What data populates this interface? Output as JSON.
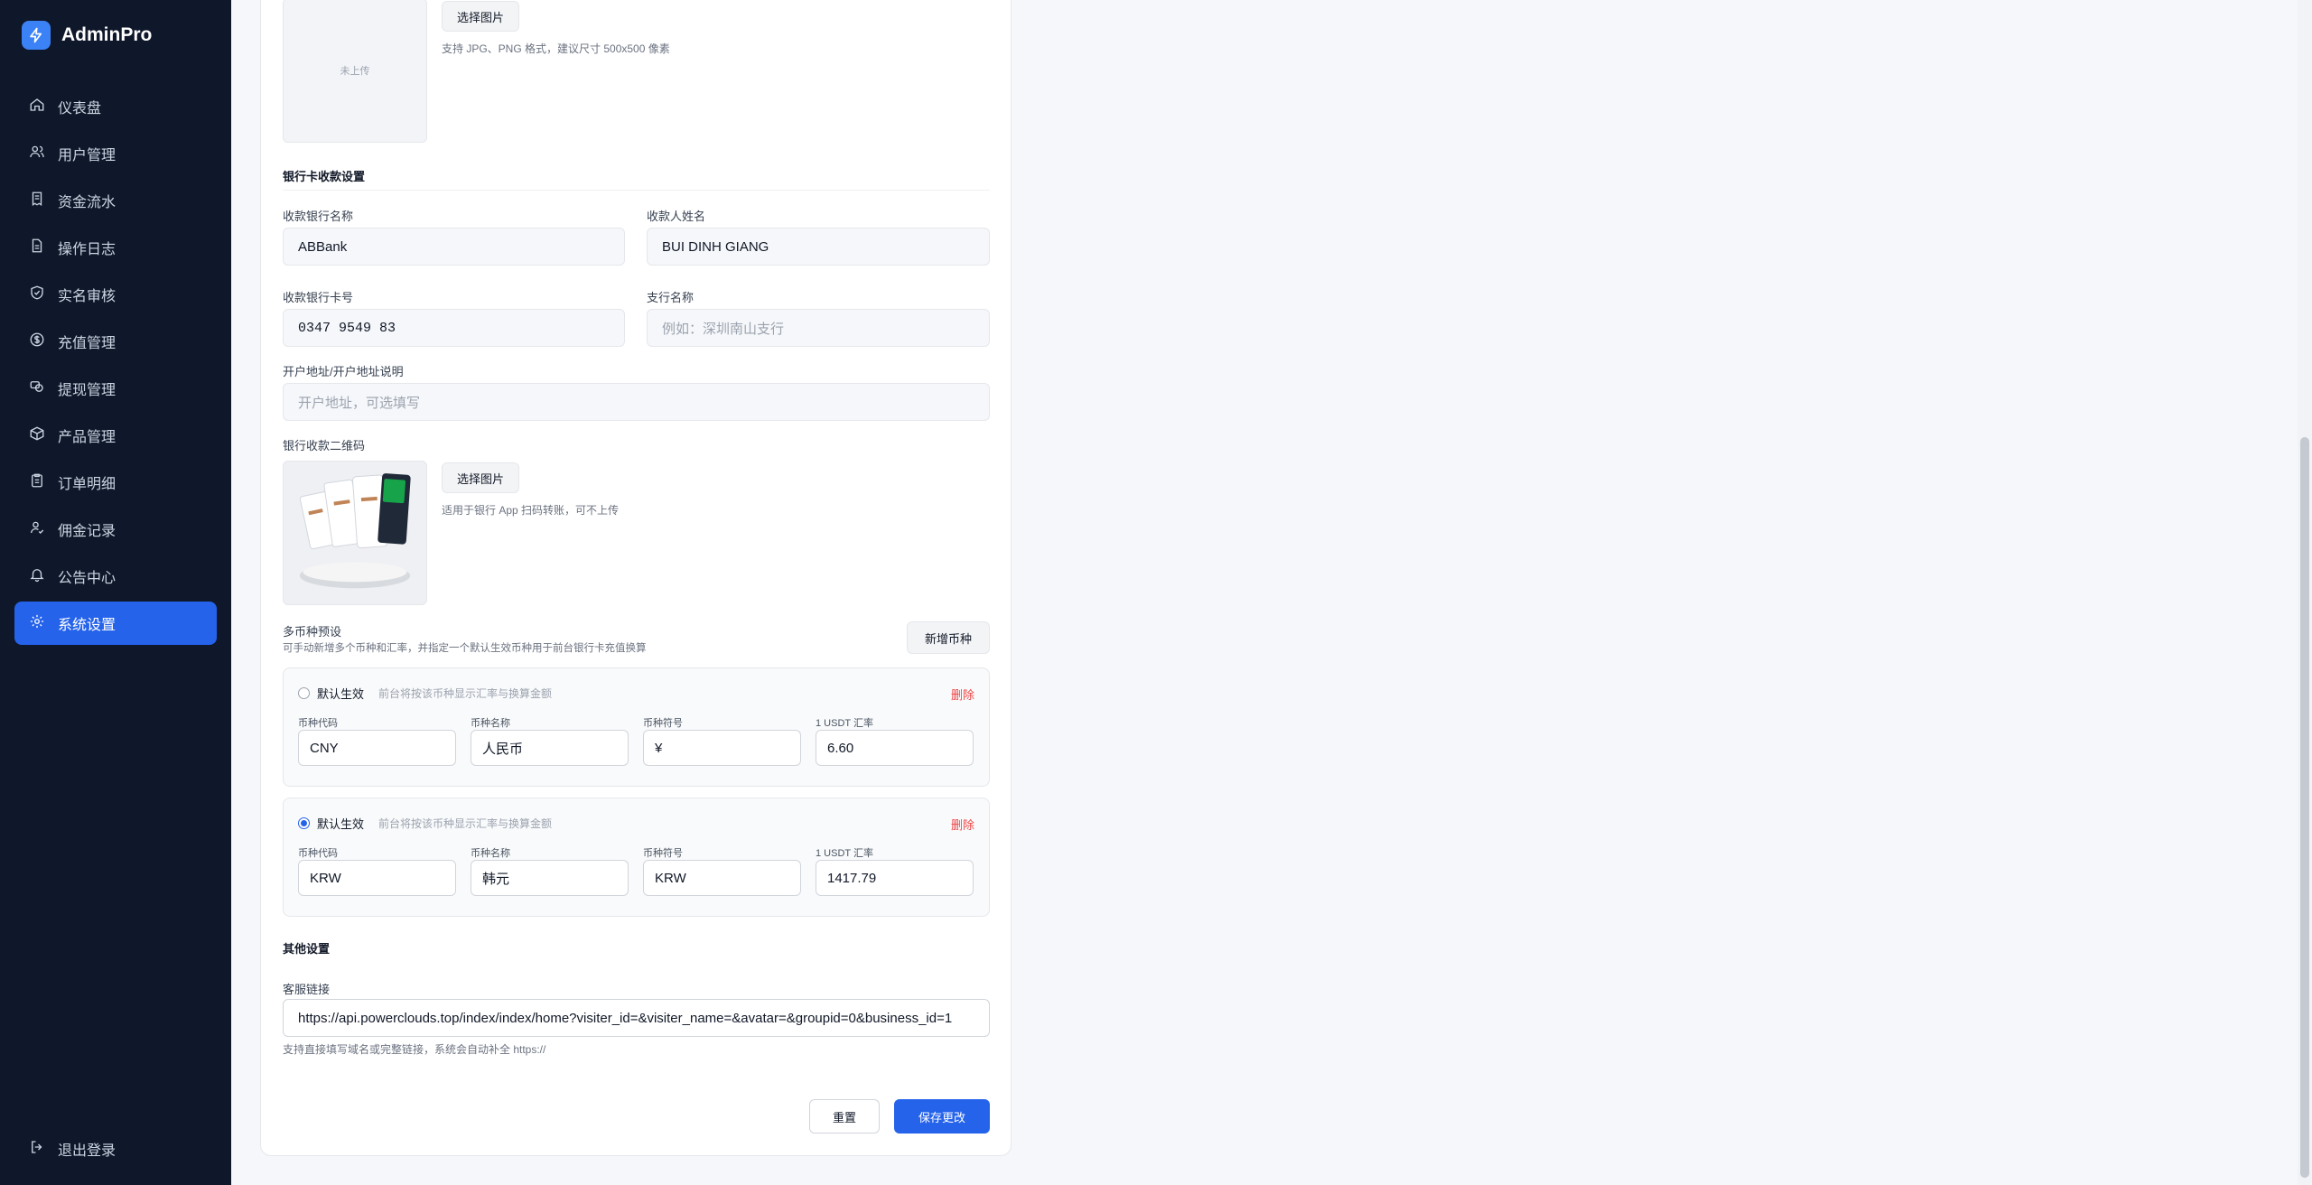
{
  "app": {
    "name": "AdminPro"
  },
  "sidebar": {
    "items": [
      {
        "label": "仪表盘",
        "icon": "home-icon"
      },
      {
        "label": "用户管理",
        "icon": "users-icon"
      },
      {
        "label": "资金流水",
        "icon": "receipt-icon"
      },
      {
        "label": "操作日志",
        "icon": "file-text-icon"
      },
      {
        "label": "实名审核",
        "icon": "shield-check-icon"
      },
      {
        "label": "充值管理",
        "icon": "dollar-circle-icon"
      },
      {
        "label": "提现管理",
        "icon": "coins-icon"
      },
      {
        "label": "产品管理",
        "icon": "box-icon"
      },
      {
        "label": "订单明细",
        "icon": "clipboard-icon"
      },
      {
        "label": "佣金记录",
        "icon": "user-badge-icon"
      },
      {
        "label": "公告中心",
        "icon": "bell-icon"
      },
      {
        "label": "系统设置",
        "icon": "gear-icon",
        "active": true
      }
    ],
    "logout_label": "退出登录"
  },
  "top_upload": {
    "placeholder_text": "未上传",
    "button_label": "选择图片",
    "hint": "支持 JPG、PNG 格式，建议尺寸 500x500 像素"
  },
  "bank": {
    "section_title": "银行卡收款设置",
    "bank_name_label": "收款银行名称",
    "bank_name_value": "ABBank",
    "payee_label": "收款人姓名",
    "payee_value": "BUI DINH GIANG",
    "card_no_label": "收款银行卡号",
    "card_no_value": "0347 9549 83",
    "branch_label": "支行名称",
    "branch_placeholder": "例如：深圳南山支行",
    "address_label": "开户地址/开户地址说明",
    "address_placeholder": "开户地址，可选填写",
    "qr_label": "银行收款二维码",
    "qr_button_label": "选择图片",
    "qr_hint": "适用于银行 App 扫码转账，可不上传"
  },
  "currency": {
    "title": "多币种预设",
    "subtitle": "可手动新增多个币种和汇率，并指定一个默认生效币种用于前台银行卡充值换算",
    "add_button_label": "新增币种",
    "default_label": "默认生效",
    "default_desc": "前台将按该币种显示汇率与换算金额",
    "delete_label": "删除",
    "field_labels": {
      "code": "币种代码",
      "name": "币种名称",
      "symbol": "币种符号",
      "rate": "1 USDT 汇率"
    },
    "items": [
      {
        "code": "CNY",
        "name": "人民币",
        "symbol": "¥",
        "rate": "6.60",
        "is_default": false
      },
      {
        "code": "KRW",
        "name": "韩元",
        "symbol": "KRW",
        "rate": "1417.79",
        "is_default": true
      }
    ]
  },
  "other": {
    "section_title": "其他设置",
    "service_link_label": "客服链接",
    "service_link_value": "https://api.powerclouds.top/index/index/home?visiter_id=&visiter_name=&avatar=&groupid=0&business_id=1",
    "service_link_hint": "支持直接填写域名或完整链接，系统会自动补全 https://"
  },
  "actions": {
    "reset_label": "重置",
    "save_label": "保存更改"
  },
  "colors": {
    "sidebar_bg": "#0f172a",
    "accent": "#2563eb",
    "danger": "#ef4444"
  }
}
